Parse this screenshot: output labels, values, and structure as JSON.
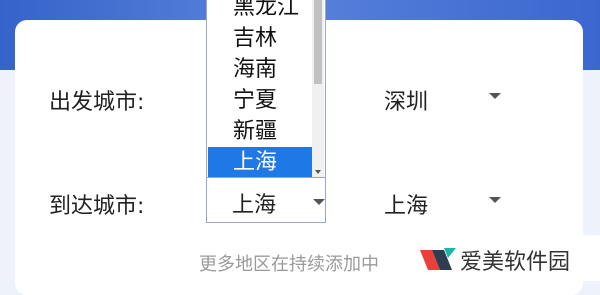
{
  "form": {
    "depart_label": "出发城市:",
    "arrive_label": "到达城市:",
    "depart_city_selected": "深圳",
    "arrive_province_selected": "上海",
    "arrive_city_selected": "上海"
  },
  "province_dropdown": {
    "options": [
      "黑龙江",
      "吉林",
      "海南",
      "宁夏",
      "新疆",
      "上海"
    ],
    "selected_index": 5
  },
  "footer": {
    "note": "更多地区在持续添加中",
    "brand": "爱美软件园"
  },
  "colors": {
    "banner": "#3b67cf",
    "selected_option_bg": "#1e78e6"
  },
  "icons": {
    "dropdown_arrow": "caret-down-icon",
    "brand_logo": "logo-icon"
  }
}
